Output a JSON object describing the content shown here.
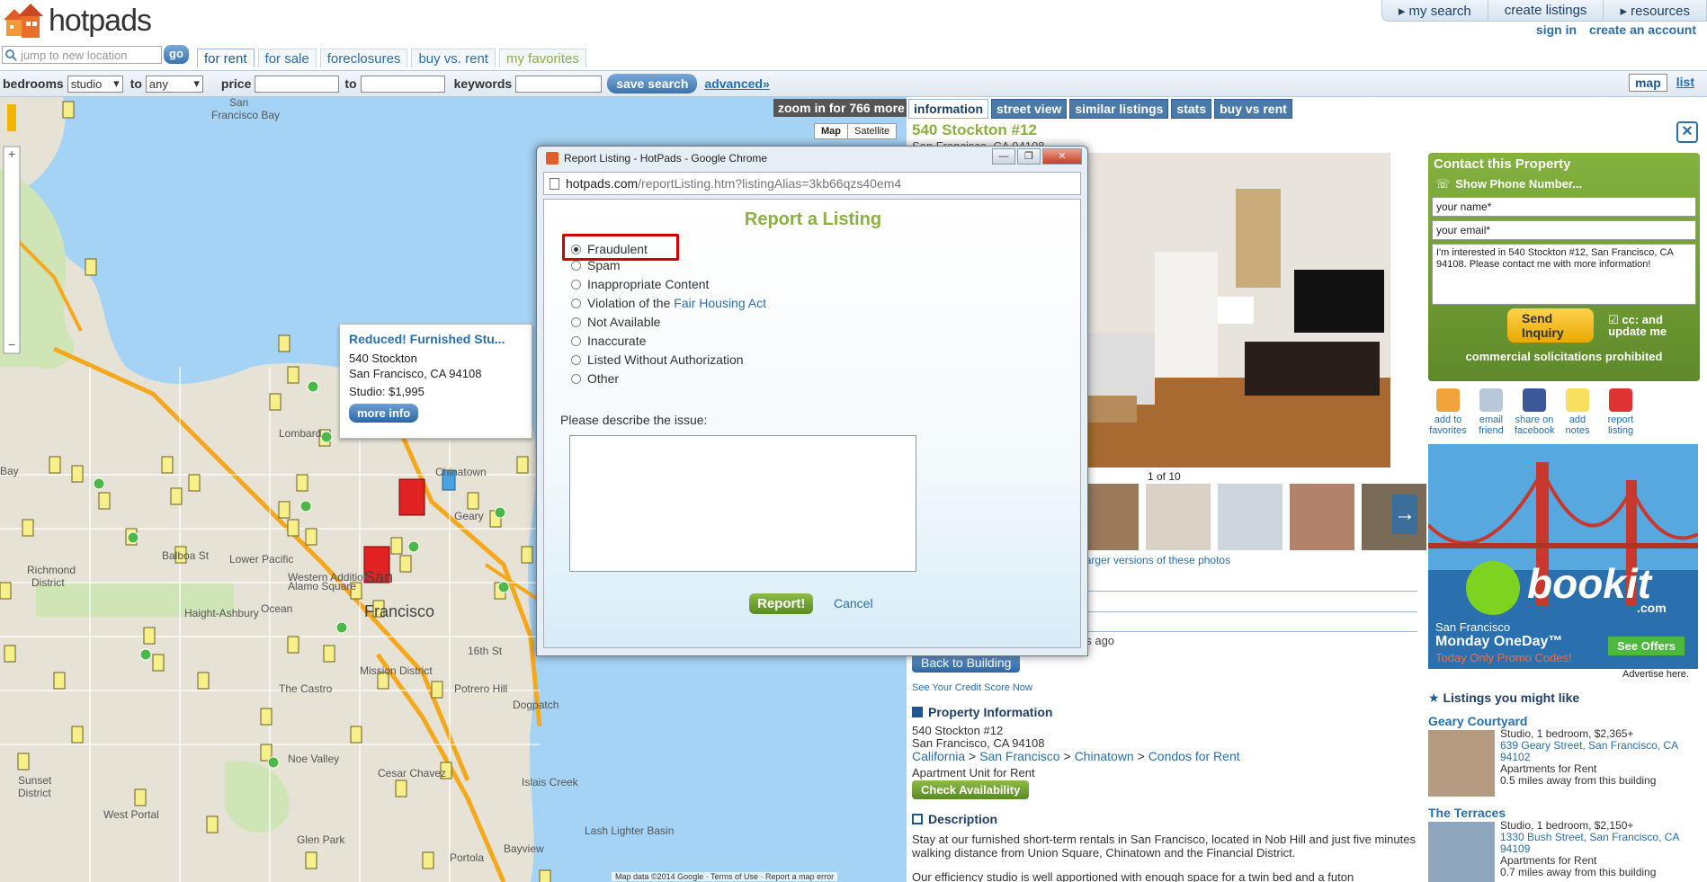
{
  "header": {
    "logo_text": "hotpads",
    "top_nav": [
      "▸ my search",
      "create listings",
      "▸ resources"
    ],
    "sign_in": "sign in",
    "create_account": "create an account",
    "search_placeholder": "jump to new location",
    "go_label": "go",
    "tabs": [
      "for rent",
      "for sale",
      "foreclosures",
      "buy vs. rent",
      "my favorites"
    ],
    "active_tab": "for rent"
  },
  "filters": {
    "bedrooms_label": "bedrooms",
    "bedrooms_from": "studio",
    "to_label": "to",
    "bedrooms_to": "any",
    "price_label": "price",
    "price_to_label": "to",
    "keywords_label": "keywords",
    "save_search": "save search",
    "advanced": "advanced»",
    "view_map": "map",
    "view_list": "list"
  },
  "map": {
    "zoom_note": "zoom in for 766 more",
    "type_map": "Map",
    "type_satellite": "Satellite",
    "labels": [
      "San Francisco Bay",
      "Bay",
      "Richmond District",
      "Sunset District",
      "West Portal",
      "Haight-Ashbury",
      "The Castro",
      "Noe Valley",
      "Glen Park",
      "Portola",
      "Lombard",
      "Chinatown",
      "Lower Pacific",
      "Western Addition",
      "Alamo Square",
      "Mission District",
      "Potrero Hill",
      "Dogpatch",
      "Islais Creek",
      "Lash Lighter Basin",
      "Bayview",
      "Cesar Chavez",
      "16th St",
      "Geary",
      "Balboa St",
      "Ocean",
      "San Francisco"
    ],
    "popup": {
      "title": "Reduced! Furnished Stu...",
      "address1": "540 Stockton",
      "address2": "San Francisco, CA 94108",
      "price": "Studio: $1,995",
      "more_info": "more info"
    },
    "footer": "Map data ©2014 Google · Terms of Use · Report a map error"
  },
  "detail": {
    "tabs": [
      "information",
      "street view",
      "similar listings",
      "stats",
      "buy vs rent"
    ],
    "title": "540 Stockton #12",
    "subtitle": "San Francisco, CA 94108",
    "photo_count": "1 of 10",
    "larger_link": "e larger versions of these photos",
    "ago_text": "ds ago",
    "back_to_building": "Back to Building",
    "credit_link": "See Your Credit Score Now",
    "property_info_head": "Property Information",
    "prop_line1": "540 Stockton #12",
    "prop_line2": "San Francisco, CA 94108",
    "breadcrumb": [
      "California",
      "San Francisco",
      "Chinatown",
      "Condos for Rent"
    ],
    "unit_type": "Apartment Unit for Rent",
    "check_availability": "Check Availability",
    "description_head": "Description",
    "description_p1": "Stay at our furnished short-term rentals in San Francisco, located in Nob Hill and just five minutes walking distance from Union Square, Chinatown and the Financial District.",
    "description_p2": "Our efficiency studio is well apportioned with enough space for a twin bed and a futon"
  },
  "contact": {
    "head": "Contact this Property",
    "phone": "Show Phone Number...",
    "name_placeholder": "your name*",
    "email_placeholder": "your email*",
    "message": "I'm interested in 540 Stockton #12, San Francisco, CA 94108. Please contact me with more information!",
    "send": "Send Inquiry",
    "cc": "cc: and update me",
    "notice": "commercial solicitations prohibited"
  },
  "actions": [
    {
      "label": "add to favorites",
      "icon": "thumbs-up-icon",
      "color": "#f2a33a"
    },
    {
      "label": "email friend",
      "icon": "envelope-icon",
      "color": "#b9c8d8"
    },
    {
      "label": "share on facebook",
      "icon": "facebook-icon",
      "color": "#3b5998"
    },
    {
      "label": "add notes",
      "icon": "note-icon",
      "color": "#f6e05e"
    },
    {
      "label": "report listing",
      "icon": "report-icon",
      "color": "#d33"
    }
  ],
  "ad": {
    "brand": "bookit",
    "brand_suffix": ".com",
    "city": "San Francisco",
    "deal": "Monday OneDay™",
    "promo": "Today Only Promo Codes!",
    "cta": "See Offers",
    "advertise": "Advertise here."
  },
  "listings_like": {
    "head": "Listings you might like",
    "items": [
      {
        "name": "Geary Courtyard",
        "summary": "Studio, 1 bedroom, $2,365+",
        "address": "639 Geary Street, San Francisco, CA 94102",
        "type": "Apartments for Rent",
        "distance": "0.5 miles away from this building"
      },
      {
        "name": "The Terraces",
        "summary": "Studio, 1 bedroom, $2,150+",
        "address": "1330 Bush Street, San Francisco, CA 94109",
        "type": "Apartments for Rent",
        "distance": "0.7 miles away from this building"
      }
    ]
  },
  "dialog": {
    "window_title": "Report Listing - HotPads - Google Chrome",
    "url_host": "hotpads.com",
    "url_path": "/reportListing.htm?listingAlias=3kb66qzs40em4",
    "heading": "Report a Listing",
    "options": [
      "Fraudulent",
      "Spam",
      "Inappropriate Content",
      "Violation of the",
      "Not Available",
      "Inaccurate",
      "Listed Without Authorization",
      "Other"
    ],
    "fair_housing_link": "Fair Housing Act",
    "selected": "Fraudulent",
    "describe_label": "Please describe the issue:",
    "report_button": "Report!",
    "cancel": "Cancel"
  },
  "colors": {
    "accent_green": "#8cb042",
    "link_blue": "#2a6fa8",
    "highlight_red": "#d10000"
  }
}
